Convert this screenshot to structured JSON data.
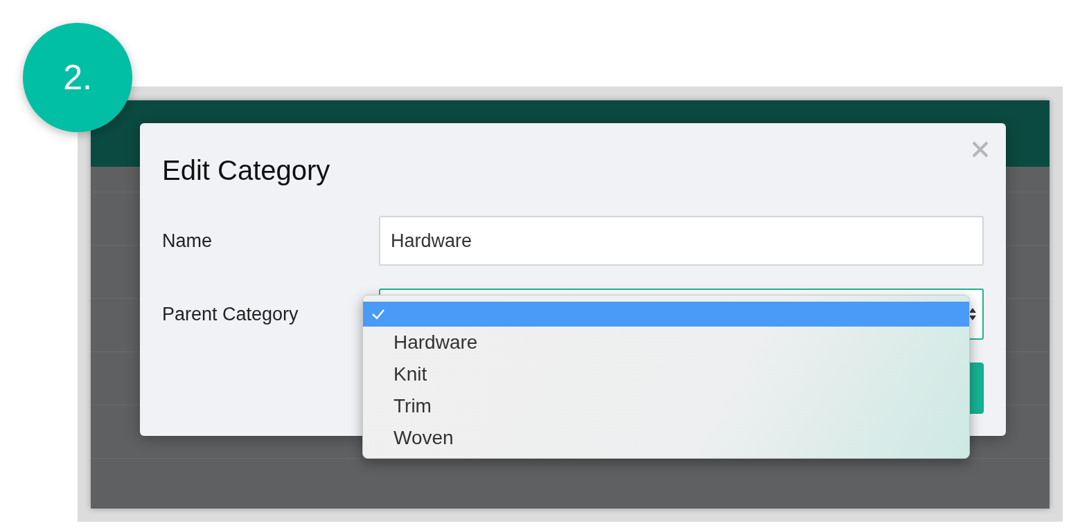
{
  "step_badge": "2.",
  "modal": {
    "title": "Edit Category",
    "fields": [
      {
        "kind": "text",
        "label": "Name",
        "value": "Hardware"
      },
      {
        "kind": "select",
        "label": "Parent Category",
        "focused": true
      }
    ]
  },
  "dropdown": {
    "options": [
      {
        "selected": true
      },
      {
        "label": "Hardware",
        "selected": false
      },
      {
        "label": "Knit",
        "selected": false
      },
      {
        "label": "Trim",
        "selected": false
      },
      {
        "label": "Woven",
        "selected": false
      }
    ]
  }
}
